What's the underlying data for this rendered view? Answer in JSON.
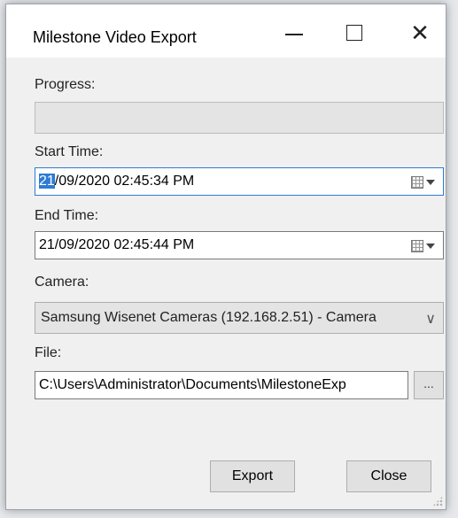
{
  "window": {
    "title": "Milestone Video Export",
    "minimize_icon": "minimize-icon",
    "maximize_icon": "maximize-icon",
    "close_glyph": "✕"
  },
  "progress": {
    "label": "Progress:",
    "value": 0
  },
  "start_time": {
    "label": "Start Time:",
    "selected_part": "21",
    "rest": "/09/2020 02:45:34 PM",
    "icon": "calendar-dropdown-icon"
  },
  "end_time": {
    "label": "End Time:",
    "value": "21/09/2020 02:45:44 PM",
    "icon": "calendar-dropdown-icon"
  },
  "camera": {
    "label": "Camera:",
    "selected": "Samsung Wisenet Cameras (192.168.2.51) - Camera",
    "arrow_glyph": "∨"
  },
  "file": {
    "label": "File:",
    "value": "C:\\Users\\Administrator\\Documents\\MilestoneExp",
    "browse_label": "..."
  },
  "buttons": {
    "export_label": "Export",
    "close_label": "Close"
  },
  "colors": {
    "accent": "#2d7bd4",
    "window_bg": "#f0f0f0"
  }
}
